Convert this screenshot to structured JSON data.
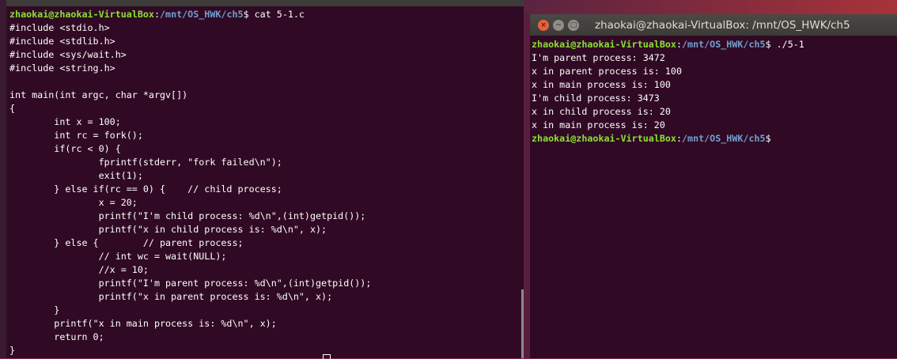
{
  "left_terminal": {
    "prompt_user": "zhaokai@zhaokai-VirtualBox",
    "prompt_path": "/mnt/OS_HWK/ch5",
    "command": "$ cat 5-1.c",
    "lines": [
      "#include <stdio.h>",
      "#include <stdlib.h>",
      "#include <sys/wait.h>",
      "#include <string.h>",
      "",
      "int main(int argc, char *argv[])",
      "{",
      "        int x = 100;",
      "        int rc = fork();",
      "        if(rc < 0) {",
      "                fprintf(stderr, \"fork failed\\n\");",
      "                exit(1);",
      "        } else if(rc == 0) {    // child process;",
      "                x = 20;",
      "                printf(\"I'm child process: %d\\n\",(int)getpid());",
      "                printf(\"x in child process is: %d\\n\", x);",
      "        } else {        // parent process;",
      "                // int wc = wait(NULL);",
      "                //x = 10;",
      "                printf(\"I'm parent process: %d\\n\",(int)getpid());",
      "                printf(\"x in parent process is: %d\\n\", x);",
      "        }",
      "        printf(\"x in main process is: %d\\n\", x);",
      "        return 0;",
      "}"
    ]
  },
  "right_terminal": {
    "title": "zhaokai@zhaokai-VirtualBox: /mnt/OS_HWK/ch5",
    "prompt_user": "zhaokai@zhaokai-VirtualBox",
    "prompt_path": "/mnt/OS_HWK/ch5",
    "command": "$ ./5-1",
    "output": [
      "I'm parent process: 3472",
      "x in parent process is: 100",
      "x in main process is: 100",
      "I'm child process: 3473",
      "x in child process is: 20",
      "x in main process is: 20"
    ],
    "final_prompt_suffix": "$"
  },
  "window_buttons": {
    "close": "×",
    "minimize": "−",
    "maximize": "□"
  }
}
